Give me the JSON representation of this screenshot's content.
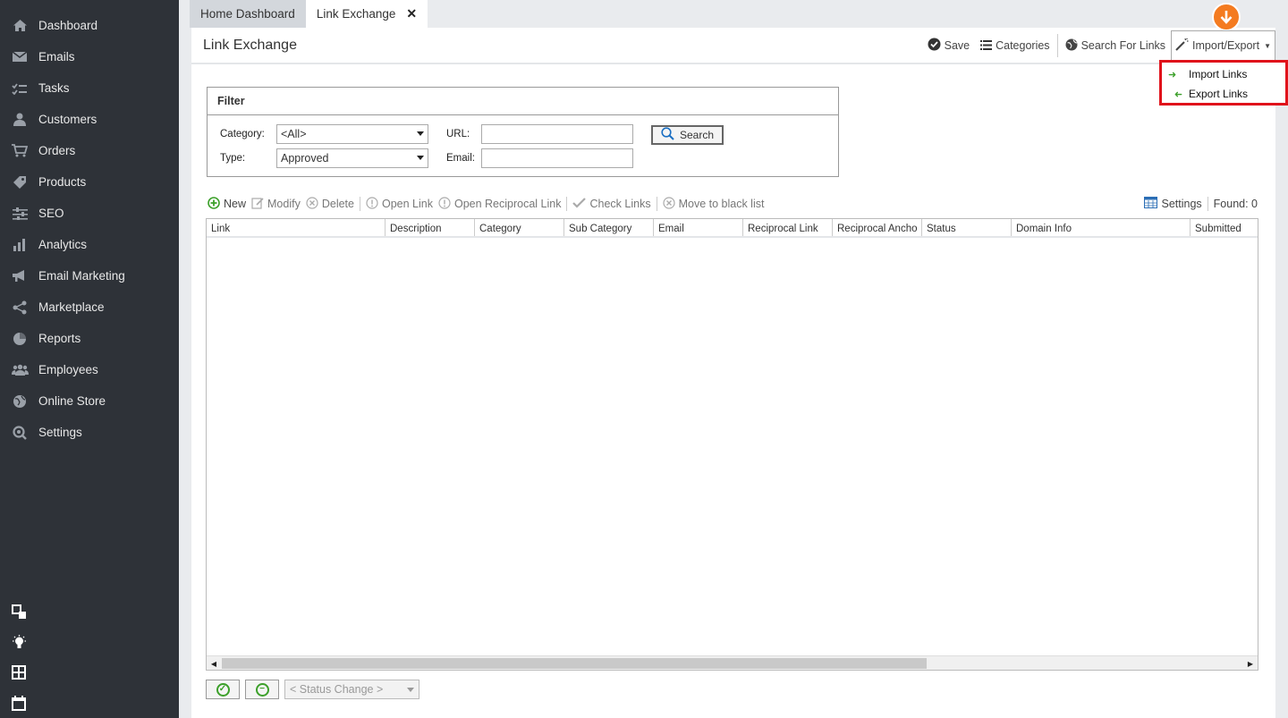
{
  "sidebar": {
    "items": [
      {
        "label": "Dashboard",
        "icon": "home-icon"
      },
      {
        "label": "Emails",
        "icon": "envelope-icon"
      },
      {
        "label": "Tasks",
        "icon": "tasks-icon"
      },
      {
        "label": "Customers",
        "icon": "user-icon"
      },
      {
        "label": "Orders",
        "icon": "cart-icon"
      },
      {
        "label": "Products",
        "icon": "tag-icon"
      },
      {
        "label": "SEO",
        "icon": "sliders-icon"
      },
      {
        "label": "Analytics",
        "icon": "bar-chart-icon"
      },
      {
        "label": "Email Marketing",
        "icon": "megaphone-icon"
      },
      {
        "label": "Marketplace",
        "icon": "share-icon"
      },
      {
        "label": "Reports",
        "icon": "pie-chart-icon"
      },
      {
        "label": "Employees",
        "icon": "users-icon"
      },
      {
        "label": "Online Store",
        "icon": "globe-icon"
      },
      {
        "label": "Settings",
        "icon": "gear-search-icon"
      }
    ],
    "bottom_icons": [
      "windows-icon",
      "lightbulb-icon",
      "calculator-icon",
      "calendar-icon"
    ]
  },
  "tabs": [
    {
      "label": "Home Dashboard"
    },
    {
      "label": "Link Exchange"
    }
  ],
  "page": {
    "title": "Link Exchange"
  },
  "header_actions": {
    "save": "Save",
    "categories": "Categories",
    "search_for_links": "Search For Links",
    "import_export": "Import/Export"
  },
  "dropdown": {
    "items": [
      "Import Links",
      "Export Links"
    ]
  },
  "filter": {
    "title": "Filter",
    "category_label": "Category:",
    "category_value": "<All>",
    "type_label": "Type:",
    "type_value": "Approved",
    "url_label": "URL:",
    "url_value": "",
    "email_label": "Email:",
    "email_value": "",
    "search_button": "Search"
  },
  "toolbar": {
    "new": "New",
    "modify": "Modify",
    "delete": "Delete",
    "open_link": "Open Link",
    "open_reciprocal_link": "Open Reciprocal Link",
    "check_links": "Check Links",
    "move_to_black_list": "Move to black list",
    "settings": "Settings",
    "found": "Found: 0"
  },
  "grid": {
    "columns": [
      "Link",
      "Description",
      "Category",
      "Sub Category",
      "Email",
      "Reciprocal Link",
      "Reciprocal Ancho",
      "Status",
      "Domain Info",
      "Submitted"
    ]
  },
  "bottom": {
    "status_change": "< Status Change >"
  },
  "colors": {
    "sidebar_bg": "#2e3238",
    "accent_orange": "#f47b20",
    "highlight_red": "#e0121b",
    "green": "#3ca02a"
  }
}
